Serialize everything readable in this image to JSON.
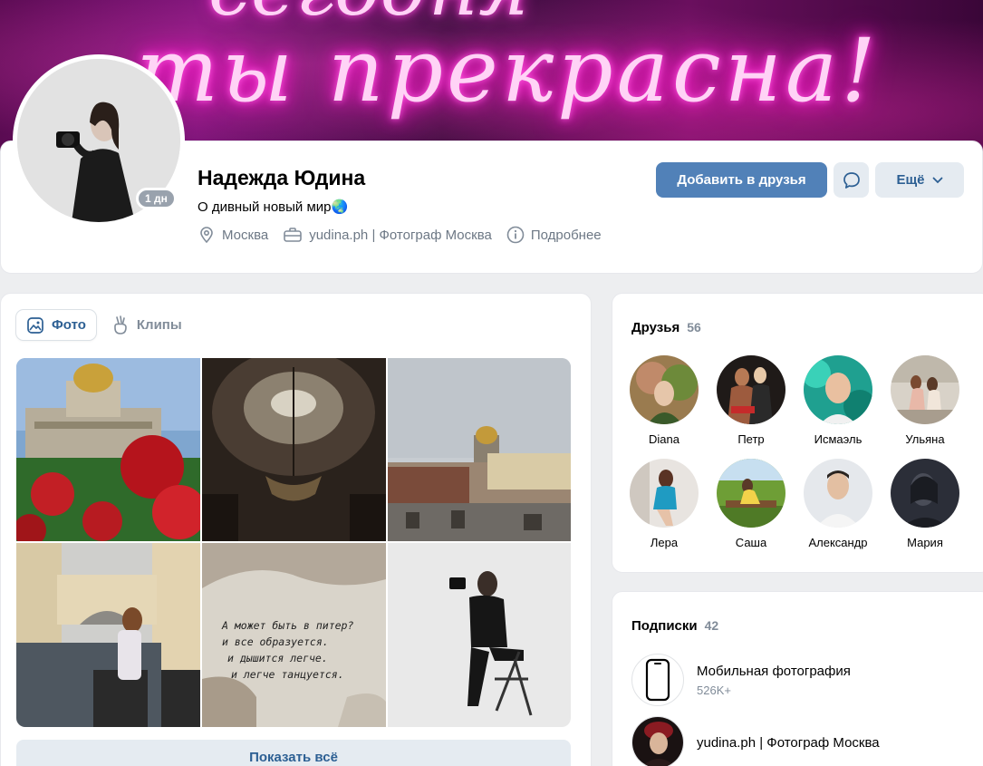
{
  "cover": {
    "neon_text": "ты прекрасна!",
    "neon_text_top": "сегодня"
  },
  "profile": {
    "name": "Надежда Юдина",
    "status": "О дивный новый мир🌏",
    "online_badge": "1 дн",
    "location": "Москва",
    "work": "yudina.ph | Фотограф Москва",
    "more_info": "Подробнее",
    "add_friend": "Добавить в друзья",
    "more": "Ещё"
  },
  "photos": {
    "tabs": [
      {
        "label": "Фото",
        "active": true,
        "icon": "image-icon"
      },
      {
        "label": "Клипы",
        "active": false,
        "icon": "clips-icon"
      }
    ],
    "show_all": "Показать всё",
    "wall_text": [
      "А может быть в питер?",
      "и все образуется.",
      "и дышится легче.",
      "и легче танцуется."
    ]
  },
  "friends": {
    "title": "Друзья",
    "count": "56",
    "items": [
      {
        "name": "Diana",
        "color": "#8f6a49"
      },
      {
        "name": "Петр",
        "color": "#3b2b22"
      },
      {
        "name": "Исмаэль",
        "color": "#29a08a"
      },
      {
        "name": "Ульяна",
        "color": "#c4a995"
      },
      {
        "name": "Лера",
        "color": "#2c8fb0"
      },
      {
        "name": "Саша",
        "color": "#7ca33b"
      },
      {
        "name": "Александр",
        "color": "#d9dde2"
      },
      {
        "name": "Мария",
        "color": "#2c2f3b"
      }
    ]
  },
  "subscriptions": {
    "title": "Подписки",
    "count": "42",
    "items": [
      {
        "name": "Мобильная фотография",
        "sub": "526K+"
      },
      {
        "name": "yudina.ph | Фотограф Москва",
        "sub": ""
      }
    ]
  },
  "colors": {
    "accent": "#5181b8",
    "link": "#2c5f93",
    "secondary_bg": "#e5ebf1",
    "muted": "#818c99"
  }
}
